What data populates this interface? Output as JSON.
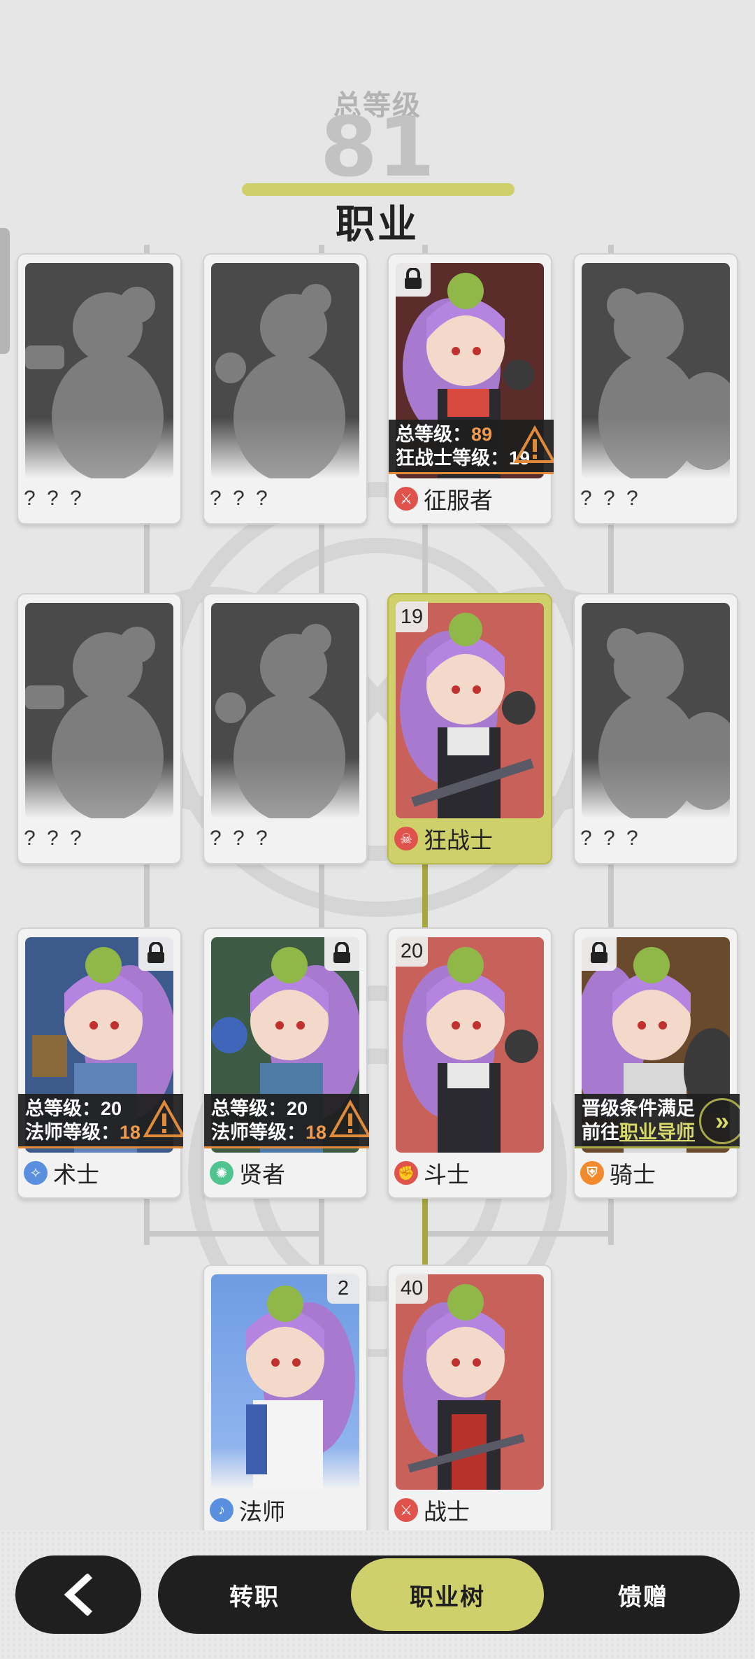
{
  "header": {
    "total_level_label": "总等级",
    "total_level_value": "81",
    "title": "职业"
  },
  "cards": {
    "row1": [
      {
        "label": "? ? ?",
        "state": "unknown"
      },
      {
        "label": "? ? ?",
        "state": "unknown"
      },
      {
        "label": "征服者",
        "state": "locked",
        "icon": "conqueror-icon",
        "icon_color": "#e0534c",
        "req_line1_prefix": "总等级：",
        "req_line1_value": "89",
        "req_line2_prefix": "狂战士等级：",
        "req_line2_value": "19"
      },
      {
        "label": "? ? ?",
        "state": "unknown"
      }
    ],
    "row2": [
      {
        "label": "? ? ?",
        "state": "unknown"
      },
      {
        "label": "? ? ?",
        "state": "unknown"
      },
      {
        "label": "狂战士",
        "state": "selected",
        "level": "19",
        "icon": "berserker-icon",
        "icon_color": "#e0534c"
      },
      {
        "label": "? ? ?",
        "state": "unknown"
      }
    ],
    "row3": [
      {
        "label": "术士",
        "state": "locked",
        "icon": "warlock-icon",
        "icon_color": "#5a8fe0",
        "req_line1_prefix": "总等级：",
        "req_line1_value": "20",
        "req_line2_prefix": "法师等级：",
        "req_line2_value": "18"
      },
      {
        "label": "贤者",
        "state": "locked",
        "icon": "sage-icon",
        "icon_color": "#4fc48f",
        "req_line1_prefix": "总等级：",
        "req_line1_value": "20",
        "req_line2_prefix": "法师等级：",
        "req_line2_value": "18"
      },
      {
        "label": "斗士",
        "state": "unlocked",
        "level": "20",
        "icon": "fighter-icon",
        "icon_color": "#e0534c"
      },
      {
        "label": "骑士",
        "state": "available",
        "icon": "knight-icon",
        "icon_color": "#f08a2c",
        "req_line1": "晋级条件满足",
        "req_line2_prefix": "前往",
        "req_line2_link": "职业导师"
      }
    ],
    "row4": [
      {
        "label": "法师",
        "state": "unlocked",
        "level": "2",
        "icon": "mage-icon",
        "icon_color": "#5a8fe0"
      },
      {
        "label": "战士",
        "state": "unlocked",
        "level": "40",
        "icon": "warrior-icon",
        "icon_color": "#e0534c"
      }
    ]
  },
  "nav": {
    "tab1": "转职",
    "tab2": "职业树",
    "tab3": "馈赠",
    "active_tab": "职业树"
  },
  "colors": {
    "accent": "#ced06b",
    "dark": "#1f1f1f",
    "warning": "#f09a4e",
    "red_bg": "#c8615a",
    "blue_bg": "#6f9be3",
    "navy_bg": "#3d5a8c",
    "green_bg": "#3d5a44",
    "brown_bg": "#6a4a2c"
  }
}
